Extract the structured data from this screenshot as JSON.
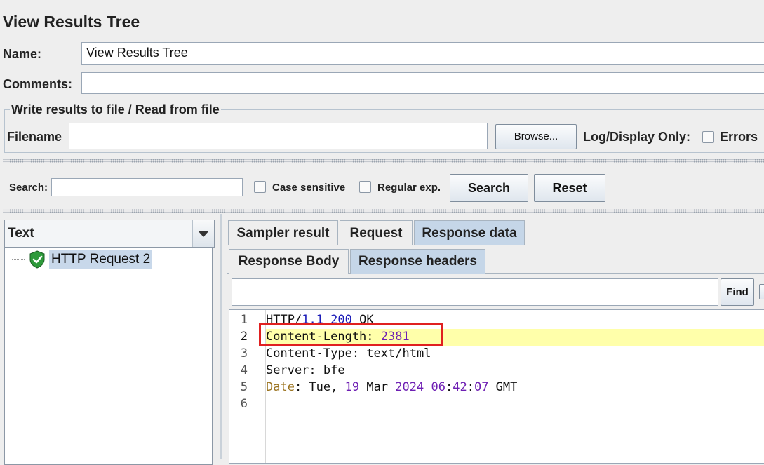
{
  "panel": {
    "title": "View Results Tree"
  },
  "name_row": {
    "label": "Name:",
    "value": "View Results Tree"
  },
  "comments_row": {
    "label": "Comments:",
    "value": ""
  },
  "file_group": {
    "legend": "Write results to file / Read from file",
    "filename_label": "Filename",
    "filename_value": "",
    "browse_label": "Browse...",
    "log_display_label": "Log/Display Only:",
    "errors_label": "Errors",
    "errors_checked": false
  },
  "search_bar": {
    "label": "Search:",
    "value": "",
    "case_sensitive_label": "Case sensitive",
    "regular_exp_label": "Regular exp.",
    "search_button": "Search",
    "reset_button": "Reset"
  },
  "renderer": {
    "selected": "Text"
  },
  "tree": {
    "items": [
      {
        "label": "HTTP Request 2",
        "status": "success",
        "selected": true
      }
    ]
  },
  "result_tabs": {
    "tabs": [
      "Sampler result",
      "Request",
      "Response data"
    ],
    "selected": "Response data"
  },
  "response_tabs": {
    "tabs": [
      "Response Body",
      "Response headers"
    ],
    "selected": "Response headers"
  },
  "find": {
    "value": "",
    "button": "Find"
  },
  "editor": {
    "line_numbers": [
      "1",
      "2",
      "3",
      "4",
      "5",
      "6"
    ],
    "current_line": 2,
    "highlight_color": "#ffffaa",
    "annotation_box_color": "#e02020",
    "lines": [
      {
        "tokens": [
          {
            "t": "HTTP",
            "c": "plain"
          },
          {
            "t": "/",
            "c": "plain"
          },
          {
            "t": "1.1",
            "c": "blue"
          },
          {
            "t": " ",
            "c": "plain"
          },
          {
            "t": "200",
            "c": "blue"
          },
          {
            "t": " OK",
            "c": "plain"
          }
        ]
      },
      {
        "tokens": [
          {
            "t": "Content-Length",
            "c": "plain"
          },
          {
            "t": ": ",
            "c": "plain"
          },
          {
            "t": "2381",
            "c": "purple"
          }
        ]
      },
      {
        "tokens": [
          {
            "t": "Content-Type",
            "c": "plain"
          },
          {
            "t": ": text/html",
            "c": "plain"
          }
        ]
      },
      {
        "tokens": [
          {
            "t": "Server",
            "c": "plain"
          },
          {
            "t": ": bfe",
            "c": "plain"
          }
        ]
      },
      {
        "tokens": [
          {
            "t": "Date",
            "c": "gold"
          },
          {
            "t": ": Tue, ",
            "c": "plain"
          },
          {
            "t": "19",
            "c": "purple"
          },
          {
            "t": " Mar ",
            "c": "plain"
          },
          {
            "t": "2024",
            "c": "purple"
          },
          {
            "t": " ",
            "c": "plain"
          },
          {
            "t": "06",
            "c": "purple"
          },
          {
            "t": ":",
            "c": "plain"
          },
          {
            "t": "42",
            "c": "purple"
          },
          {
            "t": ":",
            "c": "plain"
          },
          {
            "t": "07",
            "c": "purple"
          },
          {
            "t": " GMT",
            "c": "plain"
          }
        ]
      },
      {
        "tokens": []
      }
    ]
  }
}
